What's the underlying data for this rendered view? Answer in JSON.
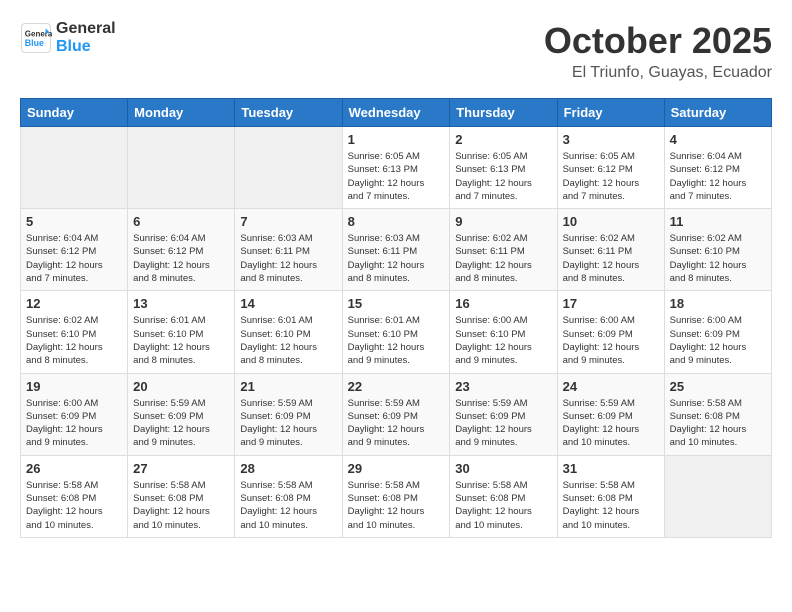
{
  "header": {
    "logo_line1": "General",
    "logo_line2": "Blue",
    "month": "October 2025",
    "location": "El Triunfo, Guayas, Ecuador"
  },
  "weekdays": [
    "Sunday",
    "Monday",
    "Tuesday",
    "Wednesday",
    "Thursday",
    "Friday",
    "Saturday"
  ],
  "weeks": [
    [
      {
        "day": "",
        "info": ""
      },
      {
        "day": "",
        "info": ""
      },
      {
        "day": "",
        "info": ""
      },
      {
        "day": "1",
        "info": "Sunrise: 6:05 AM\nSunset: 6:13 PM\nDaylight: 12 hours\nand 7 minutes."
      },
      {
        "day": "2",
        "info": "Sunrise: 6:05 AM\nSunset: 6:13 PM\nDaylight: 12 hours\nand 7 minutes."
      },
      {
        "day": "3",
        "info": "Sunrise: 6:05 AM\nSunset: 6:12 PM\nDaylight: 12 hours\nand 7 minutes."
      },
      {
        "day": "4",
        "info": "Sunrise: 6:04 AM\nSunset: 6:12 PM\nDaylight: 12 hours\nand 7 minutes."
      }
    ],
    [
      {
        "day": "5",
        "info": "Sunrise: 6:04 AM\nSunset: 6:12 PM\nDaylight: 12 hours\nand 7 minutes."
      },
      {
        "day": "6",
        "info": "Sunrise: 6:04 AM\nSunset: 6:12 PM\nDaylight: 12 hours\nand 8 minutes."
      },
      {
        "day": "7",
        "info": "Sunrise: 6:03 AM\nSunset: 6:11 PM\nDaylight: 12 hours\nand 8 minutes."
      },
      {
        "day": "8",
        "info": "Sunrise: 6:03 AM\nSunset: 6:11 PM\nDaylight: 12 hours\nand 8 minutes."
      },
      {
        "day": "9",
        "info": "Sunrise: 6:02 AM\nSunset: 6:11 PM\nDaylight: 12 hours\nand 8 minutes."
      },
      {
        "day": "10",
        "info": "Sunrise: 6:02 AM\nSunset: 6:11 PM\nDaylight: 12 hours\nand 8 minutes."
      },
      {
        "day": "11",
        "info": "Sunrise: 6:02 AM\nSunset: 6:10 PM\nDaylight: 12 hours\nand 8 minutes."
      }
    ],
    [
      {
        "day": "12",
        "info": "Sunrise: 6:02 AM\nSunset: 6:10 PM\nDaylight: 12 hours\nand 8 minutes."
      },
      {
        "day": "13",
        "info": "Sunrise: 6:01 AM\nSunset: 6:10 PM\nDaylight: 12 hours\nand 8 minutes."
      },
      {
        "day": "14",
        "info": "Sunrise: 6:01 AM\nSunset: 6:10 PM\nDaylight: 12 hours\nand 8 minutes."
      },
      {
        "day": "15",
        "info": "Sunrise: 6:01 AM\nSunset: 6:10 PM\nDaylight: 12 hours\nand 9 minutes."
      },
      {
        "day": "16",
        "info": "Sunrise: 6:00 AM\nSunset: 6:10 PM\nDaylight: 12 hours\nand 9 minutes."
      },
      {
        "day": "17",
        "info": "Sunrise: 6:00 AM\nSunset: 6:09 PM\nDaylight: 12 hours\nand 9 minutes."
      },
      {
        "day": "18",
        "info": "Sunrise: 6:00 AM\nSunset: 6:09 PM\nDaylight: 12 hours\nand 9 minutes."
      }
    ],
    [
      {
        "day": "19",
        "info": "Sunrise: 6:00 AM\nSunset: 6:09 PM\nDaylight: 12 hours\nand 9 minutes."
      },
      {
        "day": "20",
        "info": "Sunrise: 5:59 AM\nSunset: 6:09 PM\nDaylight: 12 hours\nand 9 minutes."
      },
      {
        "day": "21",
        "info": "Sunrise: 5:59 AM\nSunset: 6:09 PM\nDaylight: 12 hours\nand 9 minutes."
      },
      {
        "day": "22",
        "info": "Sunrise: 5:59 AM\nSunset: 6:09 PM\nDaylight: 12 hours\nand 9 minutes."
      },
      {
        "day": "23",
        "info": "Sunrise: 5:59 AM\nSunset: 6:09 PM\nDaylight: 12 hours\nand 9 minutes."
      },
      {
        "day": "24",
        "info": "Sunrise: 5:59 AM\nSunset: 6:09 PM\nDaylight: 12 hours\nand 10 minutes."
      },
      {
        "day": "25",
        "info": "Sunrise: 5:58 AM\nSunset: 6:08 PM\nDaylight: 12 hours\nand 10 minutes."
      }
    ],
    [
      {
        "day": "26",
        "info": "Sunrise: 5:58 AM\nSunset: 6:08 PM\nDaylight: 12 hours\nand 10 minutes."
      },
      {
        "day": "27",
        "info": "Sunrise: 5:58 AM\nSunset: 6:08 PM\nDaylight: 12 hours\nand 10 minutes."
      },
      {
        "day": "28",
        "info": "Sunrise: 5:58 AM\nSunset: 6:08 PM\nDaylight: 12 hours\nand 10 minutes."
      },
      {
        "day": "29",
        "info": "Sunrise: 5:58 AM\nSunset: 6:08 PM\nDaylight: 12 hours\nand 10 minutes."
      },
      {
        "day": "30",
        "info": "Sunrise: 5:58 AM\nSunset: 6:08 PM\nDaylight: 12 hours\nand 10 minutes."
      },
      {
        "day": "31",
        "info": "Sunrise: 5:58 AM\nSunset: 6:08 PM\nDaylight: 12 hours\nand 10 minutes."
      },
      {
        "day": "",
        "info": ""
      }
    ]
  ]
}
